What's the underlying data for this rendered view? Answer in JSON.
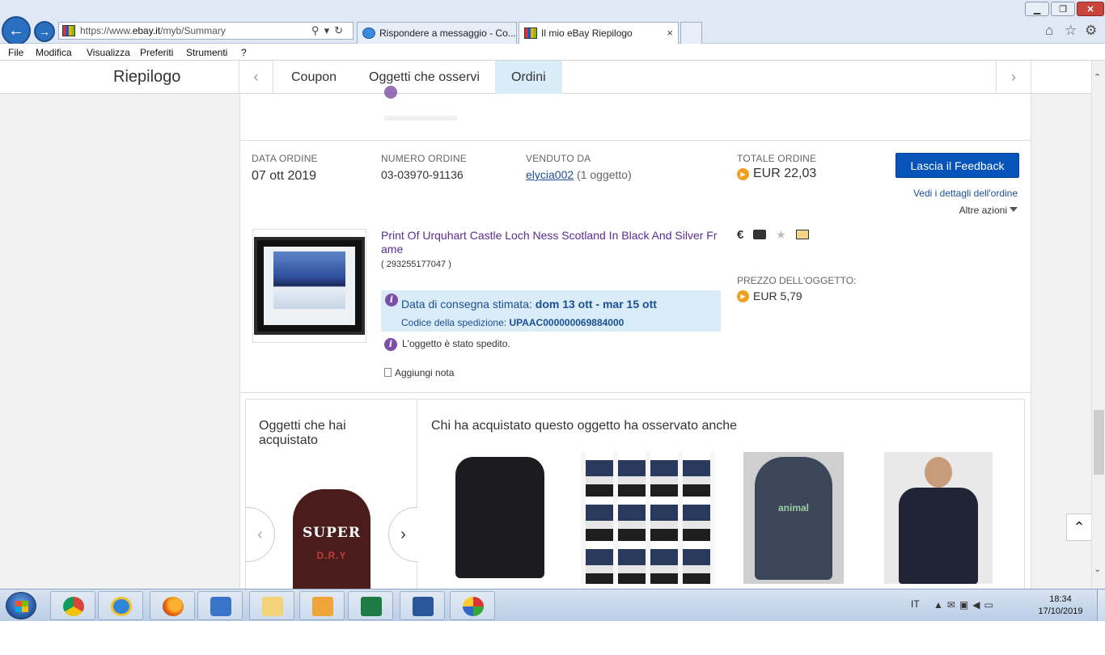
{
  "browser": {
    "address": {
      "prefix": "https://www.",
      "host": "ebay.it",
      "path": "/myb/Summary"
    },
    "tabs": [
      {
        "label": "Rispondere a messaggio - Co..."
      },
      {
        "label": "Il mio eBay Riepilogo",
        "close": "×"
      }
    ],
    "window_controls": {
      "minimize": "▁",
      "maximize": "❐",
      "close": "✕"
    },
    "menu": [
      "File",
      "Modifica",
      "Visualizza",
      "Preferiti",
      "Strumenti",
      "?"
    ]
  },
  "subnav": {
    "title": "Riepilogo",
    "tabs": [
      "Coupon",
      "Oggetti che osservi",
      "Ordini"
    ],
    "active_tab": "Ordini"
  },
  "order": {
    "date_label": "DATA ORDINE",
    "date": "07 ott 2019",
    "number_label": "NUMERO ORDINE",
    "number": "03-03970-91136",
    "seller_label": "VENDUTO DA",
    "seller": "elycia002",
    "seller_count": "(1 oggetto)",
    "total_label": "TOTALE ORDINE",
    "total": "EUR 22,03",
    "feedback_button": "Lascia il Feedback",
    "details_link": "Vedi i dettagli dell'ordine",
    "more_actions": "Altre azioni",
    "item": {
      "title": "Print Of Urquhart Castle Loch Ness Scotland In Black And Silver Frame",
      "id": "( 293255177047 )",
      "delivery_label": "Data di consegna stimata:",
      "delivery_dates": "dom 13 ott - mar 15 ott",
      "tracking_label": "Codice della spedizione:",
      "tracking_code": "UPAAC000000069884000",
      "shipped_status": "L'oggetto è stato spedito.",
      "add_note": "Aggiungi nota",
      "price_label": "PREZZO DELL'OGGETTO:",
      "price": "EUR 5,79",
      "status_icons": [
        "euro-icon",
        "paid-icon",
        "feedback-icon",
        "shipped-mail-icon"
      ],
      "euro_symbol": "€"
    }
  },
  "recommendations": {
    "left_title": "Oggetti che hai acquistato",
    "purchased_image_text": [
      "SUPER",
      "D.R.Y"
    ],
    "title": "Chi ha acquistato questo oggetto ha osservato anche",
    "items": [
      {
        "icon": "black-peacoat"
      },
      {
        "icon": "tshirt-collage"
      },
      {
        "icon": "grey-hoodie",
        "text": "animal"
      },
      {
        "icon": "quilted-jacket-model"
      }
    ]
  },
  "taskbar": {
    "language": "IT",
    "time": "18:34",
    "date": "17/10/2019",
    "apps": [
      "chrome",
      "internet-explorer",
      "firefox",
      "media-player",
      "file-explorer",
      "outlook",
      "excel",
      "word",
      "paint"
    ]
  },
  "colors": {
    "accent_blue": "#0654ba",
    "link_blue": "#1c4f93",
    "item_title_purple": "#5c2d91",
    "delivery_bg": "#d9ecf7",
    "active_tab_bg": "#d9ecf7",
    "coin_orange": "#f0a01e"
  }
}
